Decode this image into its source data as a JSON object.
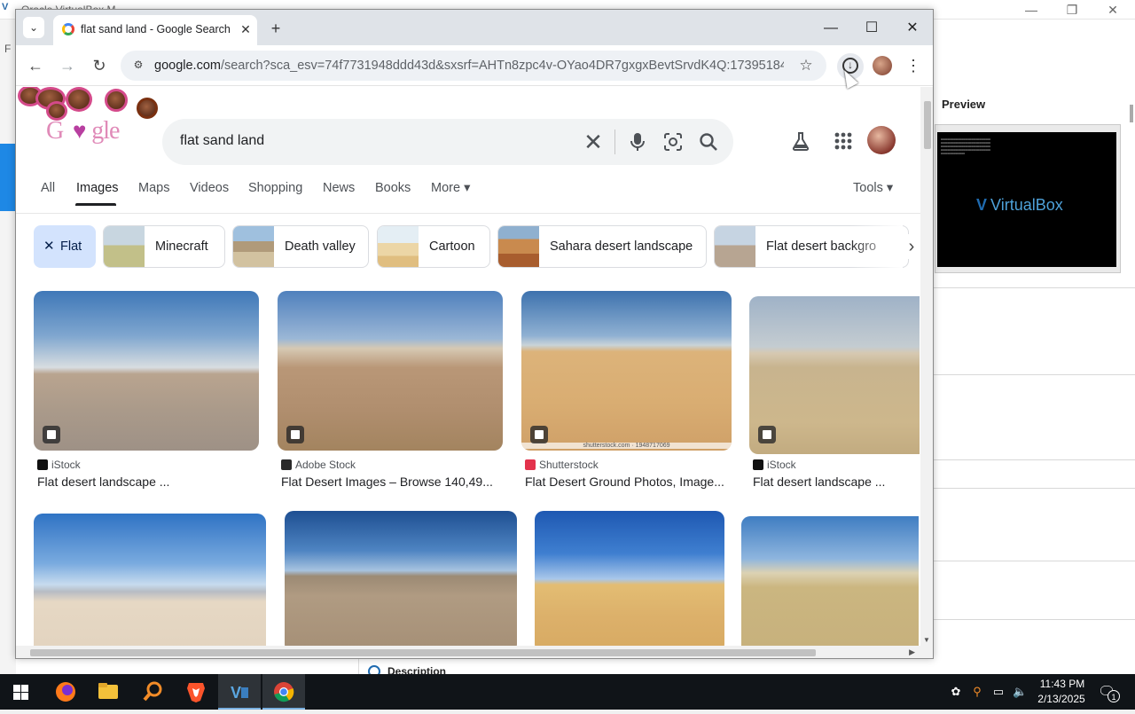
{
  "vbox": {
    "title": "Oracle VirtualBox M",
    "menu_first": "F",
    "preview_label": "Preview",
    "brand": "VirtualBox",
    "description_label": "Description",
    "minimize": "—",
    "restore": "❐",
    "close": "✕"
  },
  "chrome": {
    "tab_title": "flat sand land - Google Search",
    "tab_close": "✕",
    "new_tab": "+",
    "tab_search": "⌄",
    "minimize": "—",
    "maximize": "☐",
    "close": "✕",
    "back": "←",
    "forward": "→",
    "reload": "↻",
    "url_host": "google.com",
    "url_path": "/search?sca_esv=74f7731948ddd43d&sxsrf=AHTn8zpc4v-OYao4DR7gxgxBevtSrvdK4Q:173951841518...",
    "star": "☆",
    "menu": "⋮"
  },
  "search": {
    "query": "flat sand land",
    "clear": "✕"
  },
  "filters": {
    "items": [
      "All",
      "Images",
      "Maps",
      "Videos",
      "Shopping",
      "News",
      "Books",
      "More ▾"
    ],
    "tools": "Tools ▾"
  },
  "chips": {
    "flat": "Flat",
    "flat_x": "✕",
    "items": [
      "Minecraft",
      "Death valley",
      "Cartoon",
      "Sahara desert landscape",
      "Flat desert backgro"
    ],
    "next": "›"
  },
  "results": [
    {
      "source": "iStock",
      "title": "Flat desert landscape ...",
      "color": "#111111"
    },
    {
      "source": "Adobe Stock",
      "title": "Flat Desert Images – Browse 140,49...",
      "color": "#2a2a2a"
    },
    {
      "source": "Shutterstock",
      "title": "Flat Desert Ground Photos, Image...",
      "color": "#e3324c",
      "watermark": "shutterstock.com · 1948717069"
    },
    {
      "source": "iStock",
      "title": "Flat desert landscape ...",
      "color": "#111111"
    }
  ],
  "taskbar": {
    "time": "11:43 PM",
    "date": "2/13/2025",
    "notifications": "1"
  },
  "colors": {
    "accent_blue": "#1a73e8",
    "chip_active": "#d3e3fd",
    "taskbar": "#101418"
  }
}
